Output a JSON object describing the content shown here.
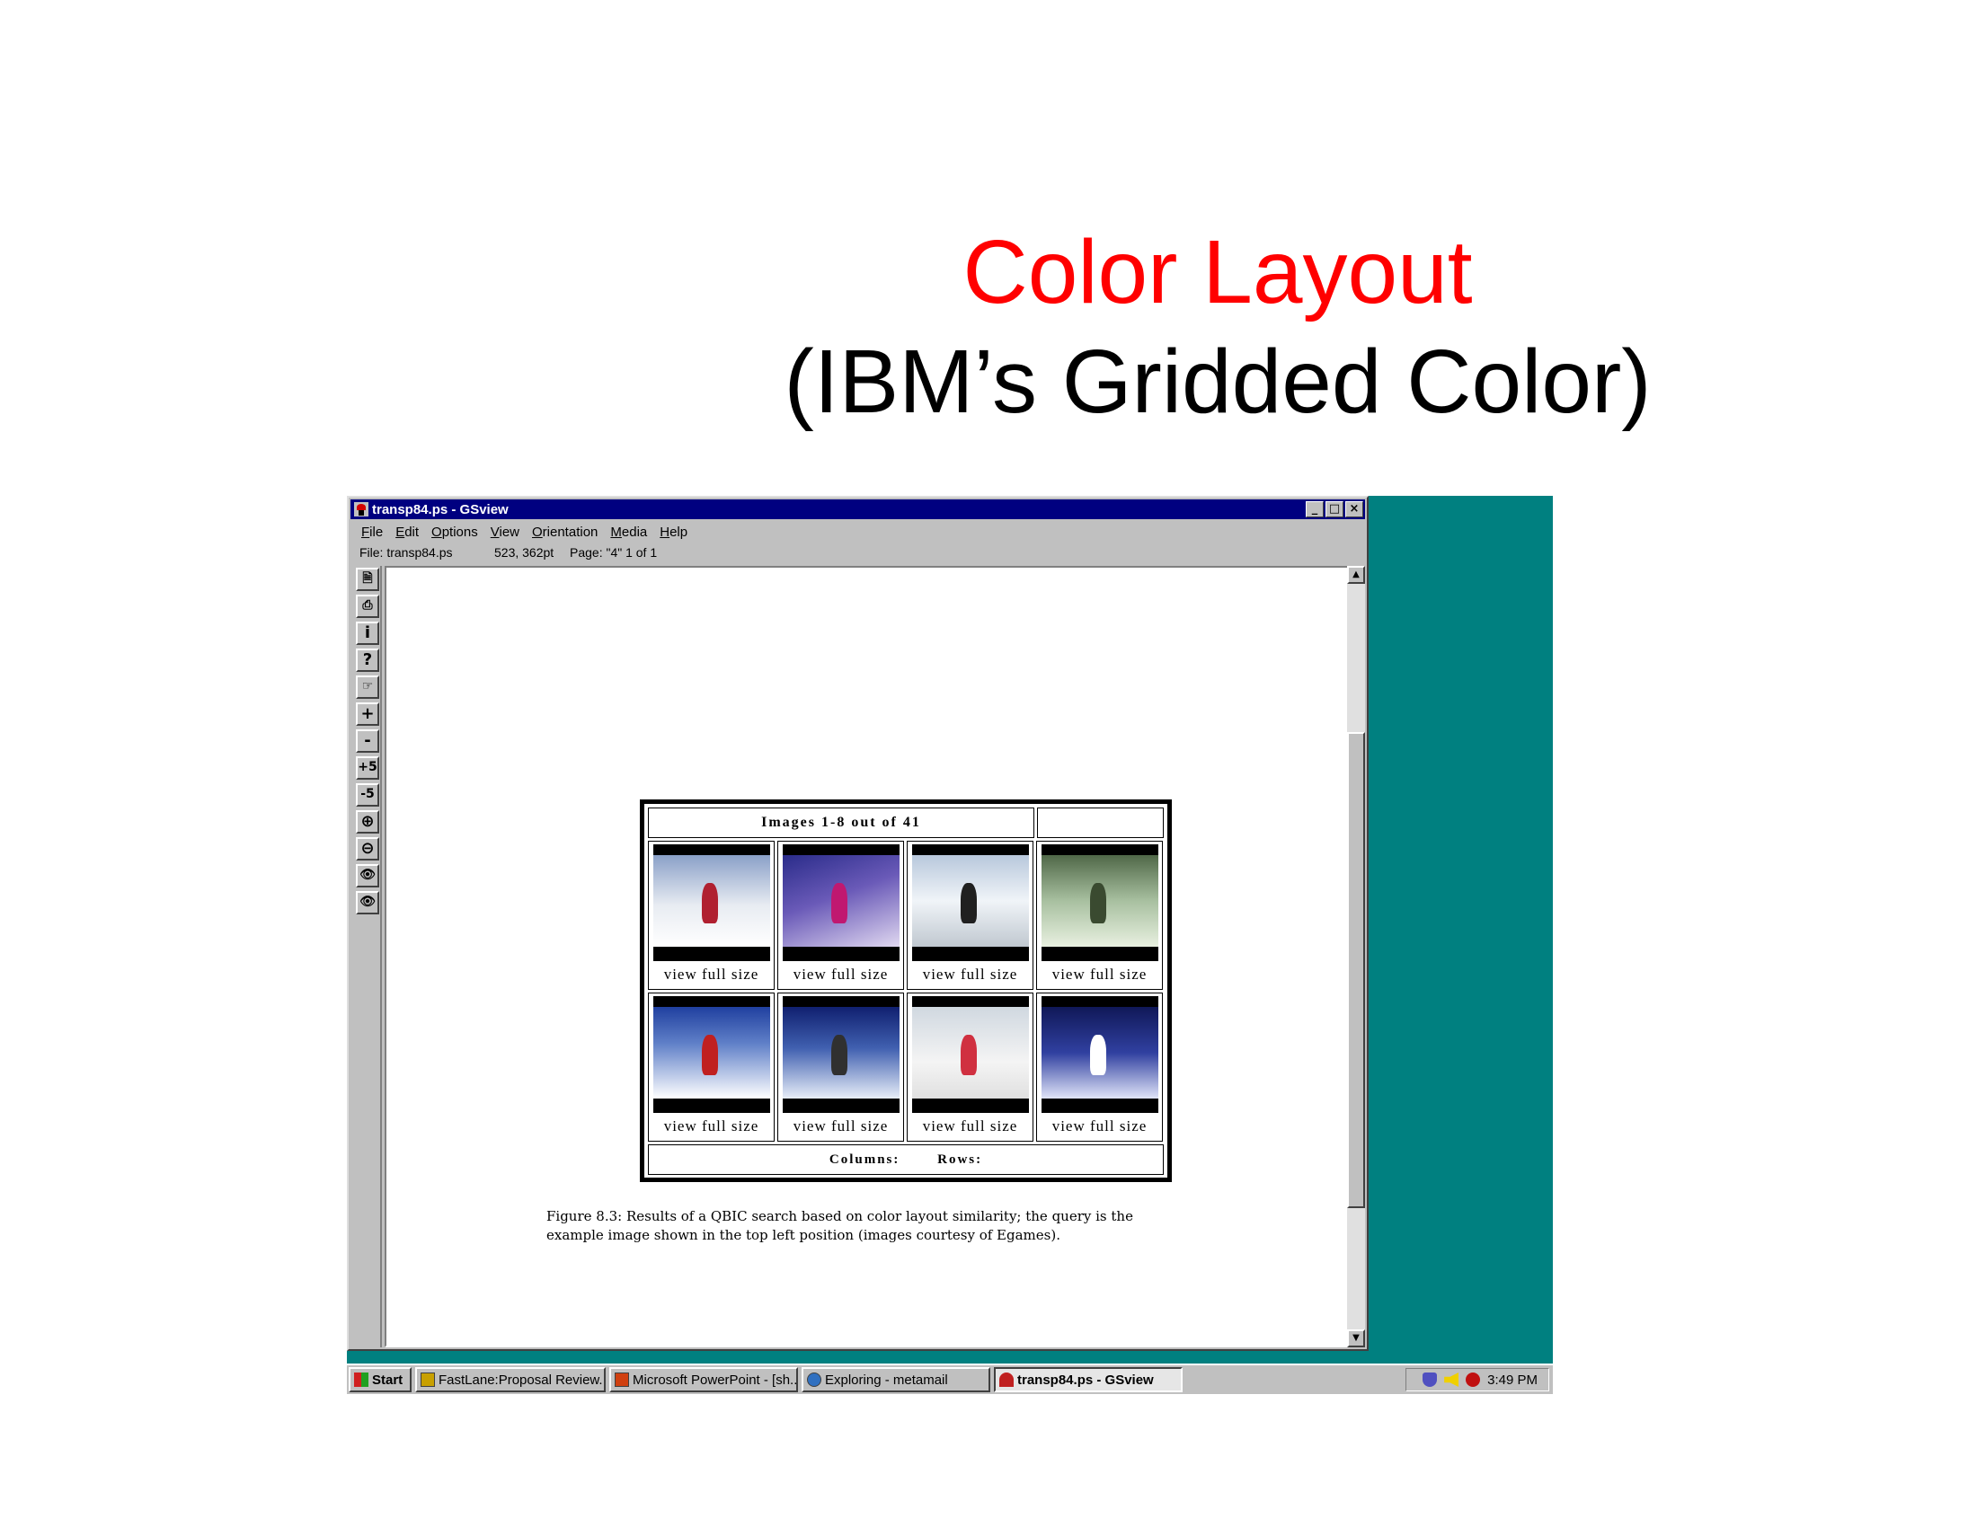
{
  "slide": {
    "title": "Color Layout",
    "subtitle": "(IBM’s Gridded Color)",
    "title_color": "#ff0000"
  },
  "window": {
    "title": "transp84.ps - GSview",
    "title_bar_color": "#000080",
    "controls": {
      "minimize": "_",
      "maximize": "□",
      "close": "×"
    },
    "menu": [
      "File",
      "Edit",
      "Options",
      "View",
      "Orientation",
      "Media",
      "Help"
    ],
    "status": {
      "file": "File: transp84.ps",
      "coords": "523, 362pt",
      "page": "Page: \"4\"  1 of 1"
    },
    "toolbar": [
      {
        "name": "open-icon",
        "glyph": "🗎"
      },
      {
        "name": "print-icon",
        "glyph": "⎙"
      },
      {
        "name": "info-icon",
        "glyph": "i"
      },
      {
        "name": "help-icon",
        "glyph": "?"
      },
      {
        "name": "goto-page-icon",
        "glyph": "☞"
      },
      {
        "name": "next-page-icon",
        "glyph": "+"
      },
      {
        "name": "prev-page-icon",
        "glyph": "-"
      },
      {
        "name": "forward-5-icon",
        "glyph": "+5"
      },
      {
        "name": "back-5-icon",
        "glyph": "-5"
      },
      {
        "name": "zoom-in-icon",
        "glyph": "⊕"
      },
      {
        "name": "zoom-out-icon",
        "glyph": "⊖"
      },
      {
        "name": "find-icon",
        "glyph": "👁"
      },
      {
        "name": "find-next-icon",
        "glyph": "👁"
      }
    ]
  },
  "qbic": {
    "header": "Images 1-8 out of 41",
    "link_label": "view full size",
    "footer_columns": "Columns:",
    "footer_rows": "Rows:",
    "thumbnails": [
      {
        "name": "skier-red-pants",
        "gradient": "linear-gradient(180deg,#8aa0c8 0%,#e8ecf2 55%,#ffffff 100%)",
        "accent": "#b02030"
      },
      {
        "name": "skier-purple-snow",
        "gradient": "linear-gradient(160deg,#2a2c8a 0%,#6a5ab8 45%,#e0d8f0 100%)",
        "accent": "#c01870"
      },
      {
        "name": "ski-lift",
        "gradient": "linear-gradient(180deg,#b8c8dc 0%,#f0f4f8 50%,#c0c8d0 100%)",
        "accent": "#202020"
      },
      {
        "name": "forest-skier",
        "gradient": "linear-gradient(180deg,#506848 0%,#a8c0a0 50%,#e8f0e0 100%)",
        "accent": "#3a4a30"
      },
      {
        "name": "skier-blue-sky",
        "gradient": "linear-gradient(180deg,#2040a0 0%,#6080c8 40%,#ffffff 100%)",
        "accent": "#c02020"
      },
      {
        "name": "skier-powder",
        "gradient": "linear-gradient(180deg,#102070 0%,#4060b0 45%,#e8eef8 100%)",
        "accent": "#303030"
      },
      {
        "name": "group-of-skiers",
        "gradient": "linear-gradient(180deg,#d0d8e0 0%,#f4f4f4 60%,#e0e0e0 100%)",
        "accent": "#d03040"
      },
      {
        "name": "skier-night-trees",
        "gradient": "linear-gradient(180deg,#101858 0%,#3040a0 50%,#e0e4f8 100%)",
        "accent": "#ffffff"
      }
    ]
  },
  "caption": {
    "line1": "Figure 8.3: Results of a QBIC search based on color layout similarity; the query is the",
    "line2": "example image shown in the top left position (images courtesy of Egames)."
  },
  "taskbar": {
    "start": "Start",
    "tasks": [
      "FastLane:Proposal Review...",
      "Microsoft PowerPoint - [sh...",
      "Exploring - metamail",
      "transp84.ps - GSview"
    ],
    "clock": "3:49 PM"
  },
  "colors": {
    "desktop": "#008080",
    "window_chrome": "#c0c0c0"
  }
}
